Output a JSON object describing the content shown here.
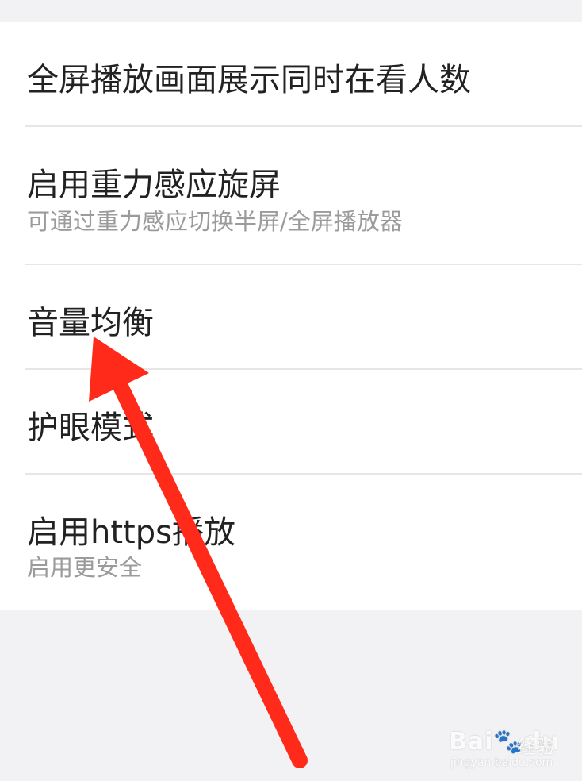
{
  "settings": {
    "items": [
      {
        "title": "全屏播放画面展示同时在看人数"
      },
      {
        "title": "启用重力感应旋屏",
        "subtitle": "可通过重力感应切换半屏/全屏播放器"
      },
      {
        "title": "音量均衡"
      },
      {
        "title": "护眼模式"
      },
      {
        "title": "启用https播放",
        "subtitle": "启用更安全"
      }
    ]
  },
  "annotation": {
    "icon": "red-arrow-icon",
    "color": "#ff2a1a"
  },
  "watermark": {
    "brand": "Bai",
    "brand2": "du",
    "cn": "经验",
    "url": "jingyan.baidu.com"
  }
}
